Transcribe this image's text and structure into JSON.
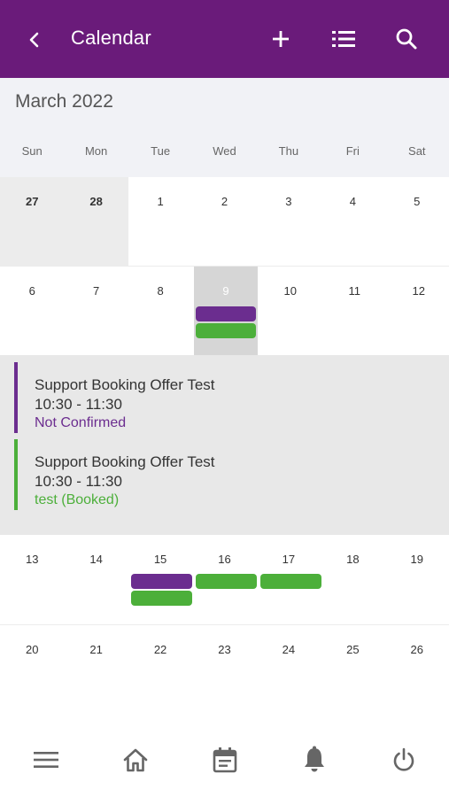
{
  "header": {
    "title": "Calendar",
    "background": "#6a1b7a",
    "icons": [
      "back-icon",
      "add-icon",
      "list-icon",
      "search-icon"
    ]
  },
  "month": {
    "label": "March 2022"
  },
  "weekdays": [
    "Sun",
    "Mon",
    "Tue",
    "Wed",
    "Thu",
    "Fri",
    "Sat"
  ],
  "weeks": [
    [
      "27",
      "28",
      "1",
      "2",
      "3",
      "4",
      "5"
    ],
    [
      "6",
      "7",
      "8",
      "9",
      "10",
      "11",
      "12"
    ],
    [
      "13",
      "14",
      "15",
      "16",
      "17",
      "18",
      "19"
    ],
    [
      "20",
      "21",
      "22",
      "23",
      "24",
      "25",
      "26"
    ]
  ],
  "selected_day": "9",
  "events": [
    {
      "title": "Support Booking Offer Test",
      "time": "10:30 - 11:30",
      "status": "Not Confirmed",
      "color": "#6b2d8f"
    },
    {
      "title": "Support Booking Offer Test",
      "time": "10:30 - 11:30",
      "status": "test (Booked)",
      "color": "#4caf3a"
    }
  ],
  "colors": {
    "not_confirmed": "#6b2d8f",
    "booked": "#4caf3a",
    "accent": "#6a1b7a"
  },
  "bottom_nav": [
    "menu-icon",
    "home-icon",
    "calendar-icon",
    "bell-icon",
    "power-icon"
  ]
}
